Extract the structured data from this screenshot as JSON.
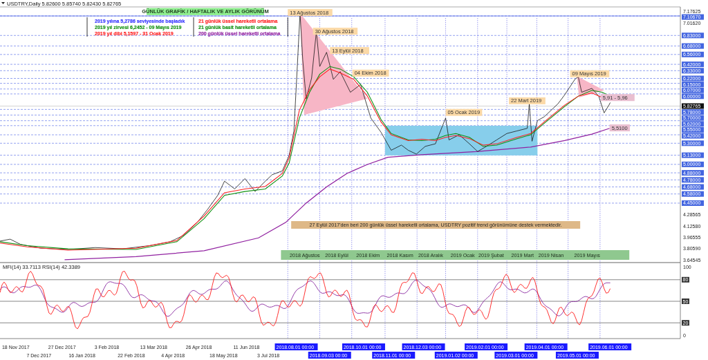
{
  "header": {
    "symbol_line": "USDTRY,Daily  5.82600 5.85740 5.82430 5.82765"
  },
  "title_box": "GÜNLÜK GRAFİK / HAFTALIK VE AYLIK GÖRÜNÜM",
  "legend_left": [
    {
      "text": "2019 yılına 5,2786 seviyesinde başladık",
      "color": "#3030ff"
    },
    {
      "text": "2019 yıl zirvesi 6,2452 - 09 Mayıs 2019",
      "color": "#109010"
    },
    {
      "text": "2019 yıl dibi 5,1597 - 31 Ocak 2019",
      "color": "#ff2020"
    }
  ],
  "legend_right": [
    {
      "text": "21 günlük üssel hareketli ortalama",
      "color": "#ff2020"
    },
    {
      "text": "21 günlük basit hareketli ortalama",
      "color": "#109010"
    },
    {
      "text": "200 günlük üssel hareketli ortalama",
      "color": "#9020a0"
    }
  ],
  "annotations": [
    {
      "text": "13 Ağustos 2018",
      "kind": "date"
    },
    {
      "text": "30 Ağustos 2018",
      "kind": "date"
    },
    {
      "text": "13 Eylül 2018",
      "kind": "date"
    },
    {
      "text": "04 Ekim 2018",
      "kind": "date"
    },
    {
      "text": "05 Ocak 2019",
      "kind": "date"
    },
    {
      "text": "22 Mart 2019",
      "kind": "date"
    },
    {
      "text": "09 Mayıs 2019",
      "kind": "date"
    },
    {
      "text": "5,91 - 5,96",
      "kind": "level"
    },
    {
      "text": "5,5100",
      "kind": "level"
    }
  ],
  "note": "27 Eylül 2017'den beri 200 günlük üssel hareketli ortalama, USDTRY pozitif trend görünümüne destek vermektedir.",
  "month_band": [
    "2018 Ağustos",
    "2018 Eylül",
    "2018 Ekim",
    "2018 Kasım",
    "2018 Aralık",
    "2019 Ocak",
    "2019 Şubat",
    "2019 Mart",
    "2019 Nisan",
    "2019 Mayıs"
  ],
  "price_axis": [
    {
      "label": "7.17625",
      "kind": "plain"
    },
    {
      "label": "7.10670",
      "kind": "level"
    },
    {
      "label": "7.01620",
      "kind": "plain"
    },
    {
      "label": "6.83000",
      "kind": "level"
    },
    {
      "label": "6.68000",
      "kind": "level"
    },
    {
      "label": "6.56000",
      "kind": "level"
    },
    {
      "label": "6.42000",
      "kind": "level"
    },
    {
      "label": "6.33000",
      "kind": "level"
    },
    {
      "label": "6.22000",
      "kind": "level"
    },
    {
      "label": "6.15000",
      "kind": "level"
    },
    {
      "label": "6.07000",
      "kind": "level"
    },
    {
      "label": "6.00000",
      "kind": "level"
    },
    {
      "label": "5.82765",
      "kind": "current"
    },
    {
      "label": "5.78000",
      "kind": "level"
    },
    {
      "label": "5.70000",
      "kind": "level"
    },
    {
      "label": "5.62000",
      "kind": "level"
    },
    {
      "label": "5.55000",
      "kind": "level"
    },
    {
      "label": "5.42000",
      "kind": "level"
    },
    {
      "label": "5.30000",
      "kind": "level"
    },
    {
      "label": "5.13000",
      "kind": "level"
    },
    {
      "label": "5.00000",
      "kind": "level"
    },
    {
      "label": "4.88000",
      "kind": "level"
    },
    {
      "label": "4.78000",
      "kind": "level"
    },
    {
      "label": "4.68000",
      "kind": "level"
    },
    {
      "label": "4.58000",
      "kind": "level"
    },
    {
      "label": "4.45000",
      "kind": "level"
    },
    {
      "label": "4.28565",
      "kind": "plain"
    },
    {
      "label": "4.12580",
      "kind": "plain"
    },
    {
      "label": "3.96555",
      "kind": "plain"
    },
    {
      "label": "3.80590",
      "kind": "plain"
    },
    {
      "label": "3.64545",
      "kind": "plain"
    }
  ],
  "indicator": {
    "label": "MFI(14) 33.7113  RSI(14) 42.3389",
    "scale": [
      {
        "label": "100",
        "kind": "plain"
      },
      {
        "label": "80",
        "kind": "level"
      },
      {
        "label": "50",
        "kind": "level"
      },
      {
        "label": "20",
        "kind": "level"
      },
      {
        "label": "0",
        "kind": "plain"
      }
    ]
  },
  "time_axis": [
    {
      "label": "18 Nov 2017",
      "highlighted": false
    },
    {
      "label": "7 Dec 2017",
      "highlighted": false
    },
    {
      "label": "27 Dec 2017",
      "highlighted": false
    },
    {
      "label": "16 Jan 2018",
      "highlighted": false
    },
    {
      "label": "3 Feb 2018",
      "highlighted": false
    },
    {
      "label": "22 Feb 2018",
      "highlighted": false
    },
    {
      "label": "13 Mar 2018",
      "highlighted": false
    },
    {
      "label": "4 Apr 2018",
      "highlighted": false
    },
    {
      "label": "26 Apr 2018",
      "highlighted": false
    },
    {
      "label": "18 May 2018",
      "highlighted": false
    },
    {
      "label": "11 Jun 2018",
      "highlighted": false
    },
    {
      "label": "3 Jul 2018",
      "highlighted": false
    },
    {
      "label": "2018.08.01 00:00",
      "highlighted": true
    },
    {
      "label": "2018.09.03 00:00",
      "highlighted": true
    },
    {
      "label": "2018.10.01 00:00",
      "highlighted": true
    },
    {
      "label": "2018.11.01 00:00",
      "highlighted": true
    },
    {
      "label": "2018.12.03 00:00",
      "highlighted": true
    },
    {
      "label": "2019.01.02 00:00",
      "highlighted": true
    },
    {
      "label": "2019.02.01 00:00",
      "highlighted": true
    },
    {
      "label": "2019.03.01 00:00",
      "highlighted": true
    },
    {
      "label": "2019.04.01 00:00",
      "highlighted": true
    },
    {
      "label": "2019.05.01 00:00",
      "highlighted": true
    },
    {
      "label": "2019.06.01 00:00",
      "highlighted": true
    }
  ]
}
